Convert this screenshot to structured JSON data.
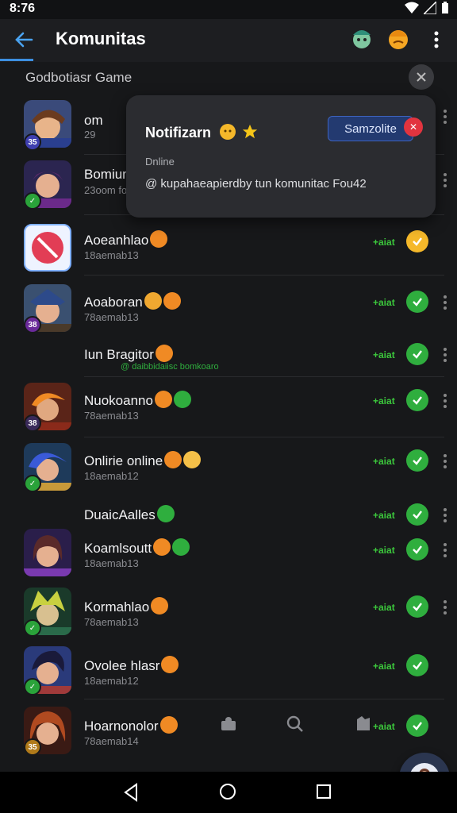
{
  "status_bar": {
    "time": "8:76"
  },
  "app_bar": {
    "title": "Komunitas"
  },
  "section": {
    "title": "Godbotiasr Game"
  },
  "notification": {
    "title": "Notifizarn",
    "button_label": "Samzolite",
    "status_label": "Dnline",
    "message": "@ kupahaeapierdby tun komunitac Fou42"
  },
  "rows": [
    {
      "name": "om",
      "sub": "29",
      "status": "",
      "avatar": "hero-brown-hair"
    },
    {
      "name": "Bomiun",
      "sub": "23oom foc",
      "status": "",
      "avatar": "hero-purple"
    },
    {
      "name": "Aoeanhlao",
      "sub": "18aemab13",
      "status": "+aiat",
      "avatar": "no-entry-app"
    },
    {
      "name": "Aoaboran",
      "sub": "78aemab13",
      "status": "+aiat",
      "avatar": "hero-cap"
    },
    {
      "name": "Iun Bragitor",
      "sub": "@ daibbidaiisc bomkoaro",
      "status": "+aiat",
      "avatar": ""
    },
    {
      "name": "Nuokoanno",
      "sub": "78aemab13",
      "status": "+aiat",
      "avatar": "hero-fire"
    },
    {
      "name": "Onlirie online",
      "sub": "18aemab12",
      "status": "+aiat",
      "avatar": "hero-blue-hair"
    },
    {
      "name": "DuaicAalles",
      "sub": "",
      "status": "+aiat",
      "avatar": ""
    },
    {
      "name": "Koamlsoutt",
      "sub": "18aemab13",
      "status": "+aiat",
      "avatar": "hero-purple-girl"
    },
    {
      "name": "Kormahlao",
      "sub": "78aemab13",
      "status": "+aiat",
      "avatar": "hero-green"
    },
    {
      "name": "Ovolee hlasr",
      "sub": "18aemab12",
      "status": "+aiat",
      "avatar": "hero-blue-warrior"
    },
    {
      "name": "Hoarnonolor",
      "sub": "78aemab14",
      "status": "+aiat",
      "avatar": "hero-red-hair"
    }
  ],
  "colors": {
    "background": "#17181a",
    "accent_blue": "#3d8fe0",
    "online_green": "#3cc83c",
    "emoji_orange": "#f08a24",
    "badge_red": "#e2343f"
  }
}
